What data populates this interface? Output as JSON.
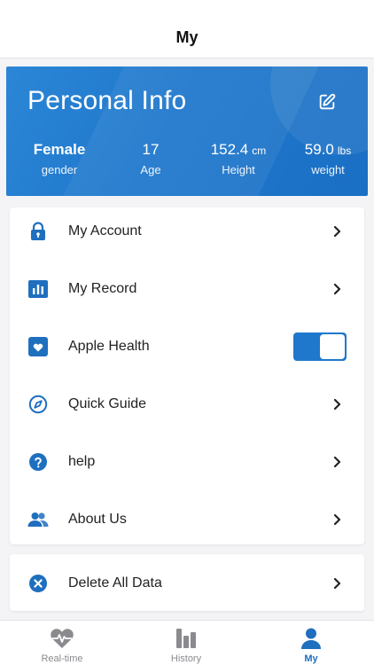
{
  "header": {
    "title": "My"
  },
  "info": {
    "title": "Personal Info",
    "gender": {
      "value": "Female",
      "label": "gender"
    },
    "age": {
      "value": "17",
      "label": "Age"
    },
    "height": {
      "value": "152.4",
      "unit": "cm",
      "label": "Height"
    },
    "weight": {
      "value": "59.0",
      "unit": "lbs",
      "label": "weight"
    }
  },
  "menu": {
    "items": [
      {
        "label": "My Account",
        "icon": "lock-icon"
      },
      {
        "label": "My Record",
        "icon": "bar-chart-icon"
      },
      {
        "label": "Apple Health",
        "icon": "heart-icon",
        "toggle_on": true
      },
      {
        "label": "Quick Guide",
        "icon": "compass-icon"
      },
      {
        "label": "help",
        "icon": "question-icon"
      },
      {
        "label": "About Us",
        "icon": "people-icon"
      }
    ],
    "delete": {
      "label": "Delete All Data",
      "icon": "close-circle-icon"
    }
  },
  "tabbar": {
    "tabs": [
      {
        "label": "Real-time",
        "icon": "heart-pulse-icon",
        "active": false
      },
      {
        "label": "History",
        "icon": "history-bars-icon",
        "active": false
      },
      {
        "label": "My",
        "icon": "person-icon",
        "active": true
      }
    ]
  },
  "colors": {
    "accent": "#1f78cc",
    "inactive": "#8a8a8f"
  }
}
